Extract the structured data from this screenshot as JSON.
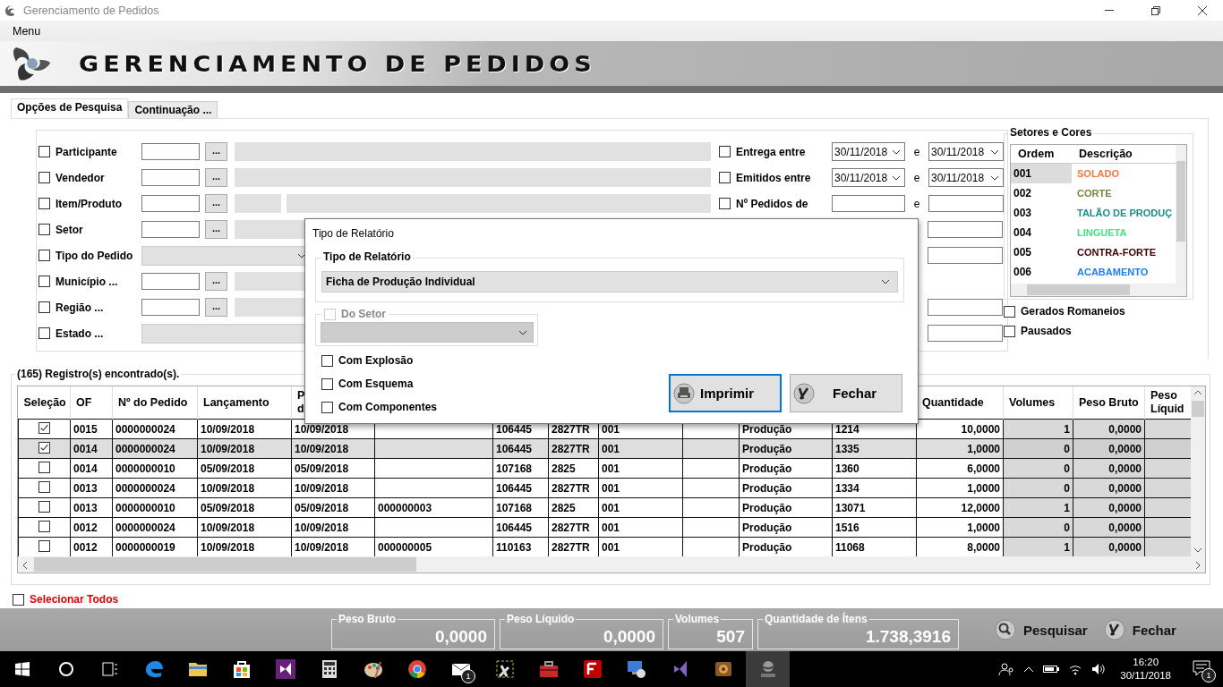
{
  "window": {
    "title": "Gerenciamento de Pedidos"
  },
  "menu": [
    "Menu"
  ],
  "banner": {
    "title": "GERENCIAMENTO DE PEDIDOS"
  },
  "tabs": [
    {
      "label": "Opções de Pesquisa",
      "selected": true
    },
    {
      "label": "Continuação ...",
      "selected": false
    }
  ],
  "filters": [
    {
      "kind": "lookup",
      "label": "Participante",
      "checked": false,
      "button": "..."
    },
    {
      "kind": "lookup",
      "label": "Vendedor",
      "checked": false,
      "button": "..."
    },
    {
      "kind": "lookup-split",
      "label": "Item/Produto",
      "checked": false,
      "button": "..."
    },
    {
      "kind": "lookup",
      "label": "Setor",
      "checked": false,
      "button": "..."
    },
    {
      "kind": "select",
      "label": "Tipo do Pedido",
      "checked": false
    },
    {
      "kind": "lookup",
      "label": "Município ...",
      "checked": false,
      "button": "..."
    },
    {
      "kind": "lookup",
      "label": "Região ...",
      "checked": false,
      "button": "..."
    },
    {
      "kind": "select-wide",
      "label": "Estado ...",
      "checked": false
    }
  ],
  "right_filters": [
    {
      "kind": "date-range",
      "label": "Entrega entre",
      "checked": false,
      "from": "30/11/2018",
      "separator": "e",
      "to": "30/11/2018"
    },
    {
      "kind": "date-range",
      "label": "Emitidos entre",
      "checked": false,
      "from": "30/11/2018",
      "separator": "e",
      "to": "30/11/2018"
    },
    {
      "kind": "range",
      "label": "Nº Pedidos de",
      "checked": false,
      "separator": "e"
    },
    {
      "kind": "covered"
    },
    {
      "kind": "covered"
    },
    {
      "kind": "hidden"
    },
    {
      "kind": "covered"
    },
    {
      "kind": "covered"
    }
  ],
  "sectors": {
    "title": "Setores e Cores",
    "columns": [
      "Ordem",
      "Descrição"
    ],
    "rows": [
      {
        "order": "001",
        "description": "SOLADO",
        "color": "#f07a3e",
        "selected": true
      },
      {
        "order": "002",
        "description": "CORTE",
        "color": "#7f7f3f",
        "selected": false
      },
      {
        "order": "003",
        "description": "TALÃO DE PRODUÇ",
        "color": "#1f8a8a",
        "selected": false
      },
      {
        "order": "004",
        "description": "LINGUETA",
        "color": "#3ee67f",
        "selected": false
      },
      {
        "order": "005",
        "description": "CONTRA-FORTE",
        "color": "#400000",
        "selected": false
      },
      {
        "order": "006",
        "description": "ACABAMENTO",
        "color": "#1e7ff0",
        "selected": false
      }
    ]
  },
  "options": [
    {
      "label": "Gerados Romaneios",
      "checked": false
    },
    {
      "label": "Pausados",
      "checked": false
    }
  ],
  "results": {
    "title": "(165) Registro(s) encontrado(s).",
    "selection_label": "Seleção",
    "columns": [
      {
        "label": "OF"
      },
      {
        "label": "Nº do Pedido"
      },
      {
        "label": "Lançamento"
      },
      {
        "label": "P\nd"
      },
      {},
      {},
      {},
      {},
      {},
      {},
      {},
      {
        "label": "Quantidade",
        "numeric": true
      },
      {
        "label": "Volumes",
        "numeric": true,
        "readonly": true
      },
      {
        "label": "Peso Bruto",
        "numeric": true,
        "readonly": true
      },
      {
        "label": "Peso Líquid",
        "readonly": true
      }
    ],
    "rows": [
      {
        "checked": true,
        "selected": false,
        "cells": [
          "0015",
          "0000000024",
          "10/09/2018",
          "10/09/2018",
          null,
          "106445",
          "2827TR",
          "001",
          null,
          "Produção",
          "1214",
          "10,0000",
          "1",
          "0,0000",
          null
        ]
      },
      {
        "checked": true,
        "selected": true,
        "cells": [
          "0014",
          "0000000024",
          "10/09/2018",
          "10/09/2018",
          null,
          "106445",
          "2827TR",
          "001",
          null,
          "Produção",
          "1335",
          "1,0000",
          "0",
          "0,0000",
          null
        ]
      },
      {
        "checked": false,
        "selected": false,
        "cells": [
          "0014",
          "0000000010",
          "05/09/2018",
          "05/09/2018",
          null,
          "107168",
          "2825",
          "001",
          null,
          "Produção",
          "1360",
          "6,0000",
          "0",
          "0,0000",
          null
        ]
      },
      {
        "checked": false,
        "selected": false,
        "cells": [
          "0013",
          "0000000024",
          "10/09/2018",
          "10/09/2018",
          null,
          "106445",
          "2827TR",
          "001",
          null,
          "Produção",
          "1334",
          "1,0000",
          "0",
          "0,0000",
          null
        ]
      },
      {
        "checked": false,
        "selected": false,
        "cells": [
          "0013",
          "0000000010",
          "05/09/2018",
          "05/09/2018",
          "000000003",
          "107168",
          "2825",
          "001",
          null,
          "Produção",
          "13071",
          "12,0000",
          "1",
          "0,0000",
          null
        ]
      },
      {
        "checked": false,
        "selected": false,
        "cells": [
          "0012",
          "0000000024",
          "10/09/2018",
          "10/09/2018",
          null,
          "106445",
          "2827TR",
          "001",
          null,
          "Produção",
          "1516",
          "1,0000",
          "0",
          "0,0000",
          null
        ]
      },
      {
        "checked": false,
        "selected": false,
        "cells": [
          "0012",
          "0000000019",
          "10/09/2018",
          "10/09/2018",
          "000000005",
          "110163",
          "2827TR",
          "001",
          null,
          "Produção",
          "11068",
          "8,0000",
          "1",
          "0,0000",
          null
        ]
      }
    ]
  },
  "select_all": {
    "label": "Selecionar Todos",
    "checked": false
  },
  "totals": [
    {
      "label": "Peso Bruto",
      "value": "0,0000"
    },
    {
      "label": "Peso Líquido",
      "value": "0,0000"
    },
    {
      "label": "Volumes",
      "value": "507"
    },
    {
      "label": "Quantidade de Ítens",
      "value": "1.738,3916"
    }
  ],
  "buttons": [
    {
      "kind": "search",
      "label": "Pesquisar"
    },
    {
      "kind": "close",
      "label": "Fechar"
    }
  ],
  "dialog": {
    "title": "Tipo de Relatório",
    "group": "Tipo de Relatório",
    "report": "Ficha de Produção Individual",
    "sector": {
      "label": "Do Setor",
      "checked": false,
      "disabled": true
    },
    "options": [
      {
        "label": "Com Explosão",
        "checked": false
      },
      {
        "label": "Com Esquema",
        "checked": false
      },
      {
        "label": "Com Componentes",
        "checked": false
      }
    ],
    "buttons": [
      {
        "kind": "print",
        "label": "Imprimir",
        "focused": true
      },
      {
        "kind": "close",
        "label": "Fechar",
        "focused": false
      }
    ]
  },
  "taskbar": {
    "apps": [
      {
        "kind": "edge",
        "active": false
      },
      {
        "kind": "folder",
        "active": false
      },
      {
        "kind": "store",
        "active": false
      },
      {
        "kind": "studio",
        "active": false
      },
      {
        "kind": "calculator",
        "active": false
      },
      {
        "kind": "palette",
        "active": false
      },
      {
        "kind": "chrome",
        "active": false
      },
      {
        "kind": "mail",
        "active": false,
        "badge": "1"
      },
      {
        "kind": "tools",
        "active": false
      },
      {
        "kind": "toolbox",
        "active": false
      },
      {
        "kind": "filezilla",
        "active": false
      },
      {
        "kind": "monitor",
        "active": false
      },
      {
        "kind": "studio2",
        "active": false
      },
      {
        "kind": "media",
        "active": false
      },
      {
        "kind": "app",
        "active": true
      }
    ],
    "time": "16:20",
    "date": "30/11/2018",
    "notification_badge": "1"
  }
}
